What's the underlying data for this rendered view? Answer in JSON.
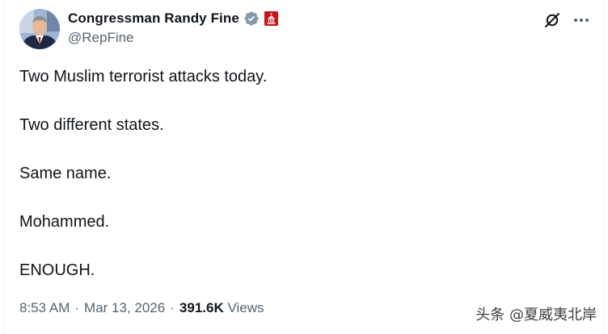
{
  "author": {
    "display_name": "Congressman Randy Fine",
    "handle": "@RepFine",
    "verified_icon": "verified-badge-grey",
    "affiliation_icon": "us-capitol-badge"
  },
  "actions": {
    "grok_icon": "grok-icon",
    "more_icon": "more-icon"
  },
  "post": {
    "lines": [
      "Two Muslim terrorist attacks today.",
      "Two different states.",
      "Same name.",
      "Mohammed.",
      "ENOUGH."
    ]
  },
  "meta": {
    "time": "8:53 AM",
    "separator": "·",
    "date": "Mar 13, 2026",
    "views_count": "391.6K",
    "views_label": "Views"
  },
  "watermark": {
    "text": "头条 @夏威夷北岸"
  },
  "colors": {
    "text": "#0f1419",
    "secondary": "#536471",
    "verified_grey": "#829aab",
    "gov_red": "#c4161c"
  }
}
